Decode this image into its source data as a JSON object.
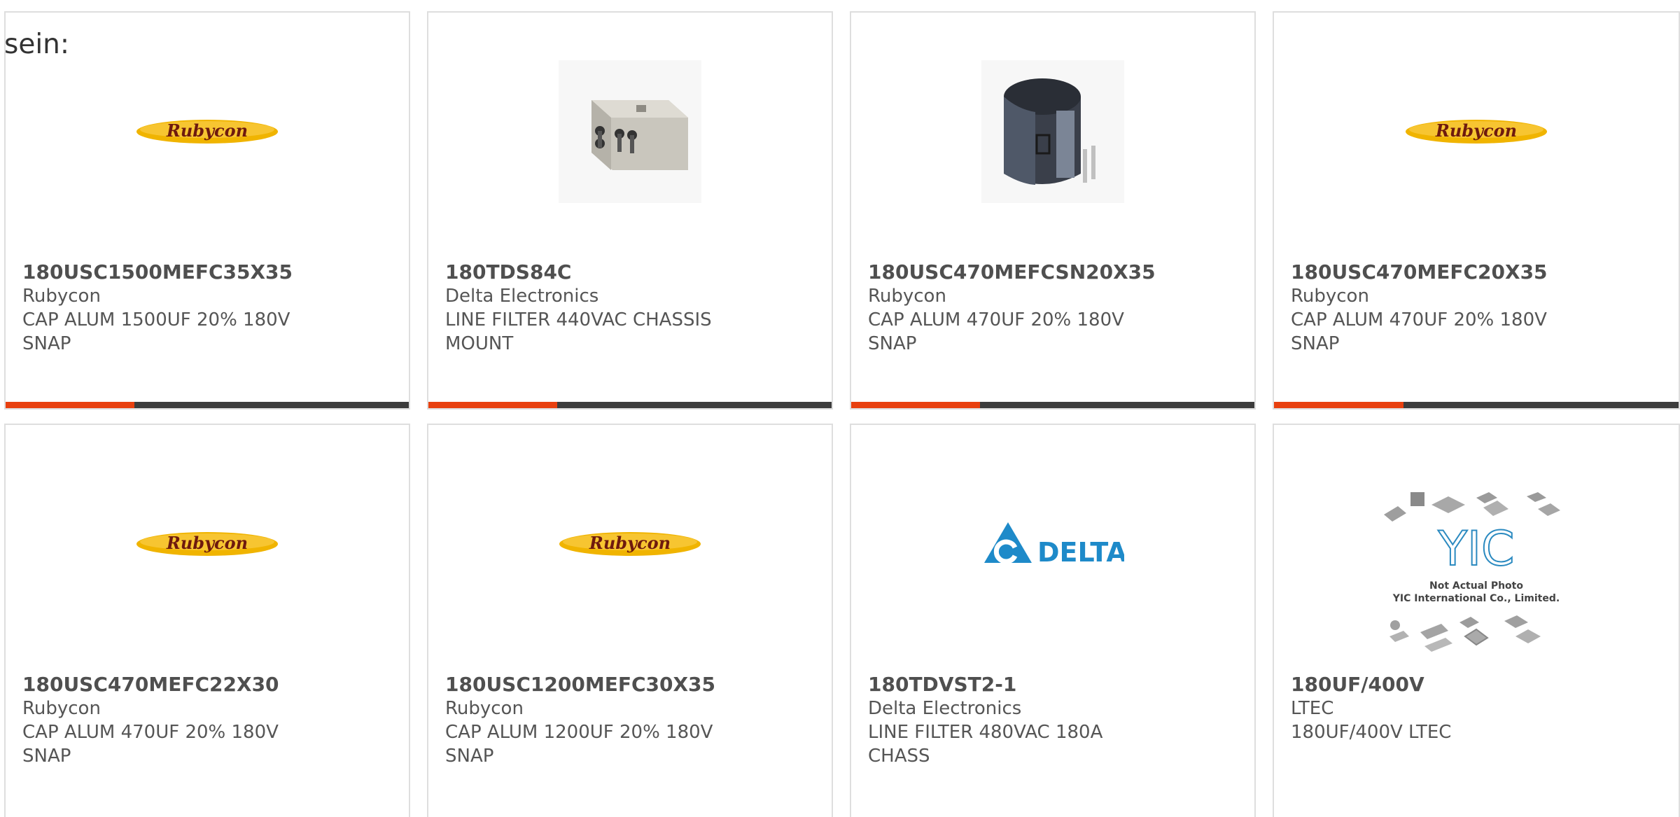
{
  "intro_text": "sein:",
  "colors": {
    "accent": "#e8400f",
    "bar": "#3c3c3c",
    "border": "#dedede",
    "text": "#555555"
  },
  "brand_logos": {
    "rubycon": "Rubycon",
    "delta": "DELTA",
    "yic": "YIC",
    "yic_line1": "Not Actual Photo",
    "yic_line2": "YIC International Co., Limited."
  },
  "cards": [
    {
      "part": "180USC1500MEFC35X35",
      "maker": "Rubycon",
      "desc": "CAP ALUM 1500UF 20% 180V SNAP",
      "image": "rubycon-logo"
    },
    {
      "part": "180TDS84C",
      "maker": "Delta Electronics",
      "desc": "LINE FILTER 440VAC CHASSIS MOUNT",
      "image": "line-filter-photo"
    },
    {
      "part": "180USC470MEFCSN20X35",
      "maker": "Rubycon",
      "desc": "CAP ALUM 470UF 20% 180V SNAP",
      "image": "capacitor-photo"
    },
    {
      "part": "180USC470MEFC20X35",
      "maker": "Rubycon",
      "desc": "CAP ALUM 470UF 20% 180V SNAP",
      "image": "rubycon-logo"
    },
    {
      "part": "180USC470MEFC22X30",
      "maker": "Rubycon",
      "desc": "CAP ALUM 470UF 20% 180V SNAP",
      "image": "rubycon-logo"
    },
    {
      "part": "180USC1200MEFC30X35",
      "maker": "Rubycon",
      "desc": "CAP ALUM 1200UF 20% 180V SNAP",
      "image": "rubycon-logo"
    },
    {
      "part": "180TDVST2-1",
      "maker": "Delta Electronics",
      "desc": "LINE FILTER 480VAC 180A CHASS",
      "image": "delta-logo"
    },
    {
      "part": "180UF/400V",
      "maker": "LTEC",
      "desc": "180UF/400V LTEC",
      "image": "yic-placeholder"
    }
  ]
}
